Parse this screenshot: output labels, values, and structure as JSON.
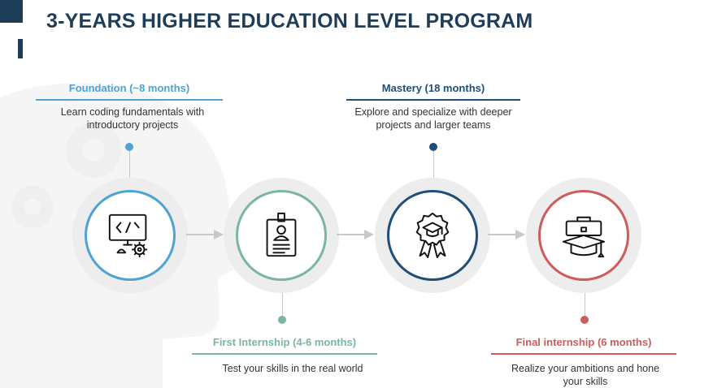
{
  "title": "3-YEARS HIGHER EDUCATION LEVEL PROGRAM",
  "colors": {
    "navy": "#1e3d59",
    "blue": "#4fa3d1",
    "teal": "#7bb5a3",
    "dark_blue": "#1f4e79",
    "red": "#cd5c5c"
  },
  "stages": [
    {
      "label": "Foundation (~8 months)",
      "description_lines": [
        "Learn coding fundamentals with",
        "introductory projects"
      ],
      "icon": "computer-code-gear-icon",
      "color": "#4fa3d1"
    },
    {
      "label": "First Internship (4-6 months)",
      "description_lines": [
        "Test your skills in the real world"
      ],
      "icon": "id-badge-icon",
      "color": "#7bb5a3"
    },
    {
      "label": "Mastery (18 months)",
      "description_lines": [
        "Explore and specialize with deeper",
        "projects and larger teams"
      ],
      "icon": "graduation-award-icon",
      "color": "#1f4e79"
    },
    {
      "label": "Final internship (6 months)",
      "description_lines": [
        "Realize your ambitions and hone",
        "your skills"
      ],
      "icon": "briefcase-graduation-cap-icon",
      "color": "#cd5c5c"
    }
  ]
}
